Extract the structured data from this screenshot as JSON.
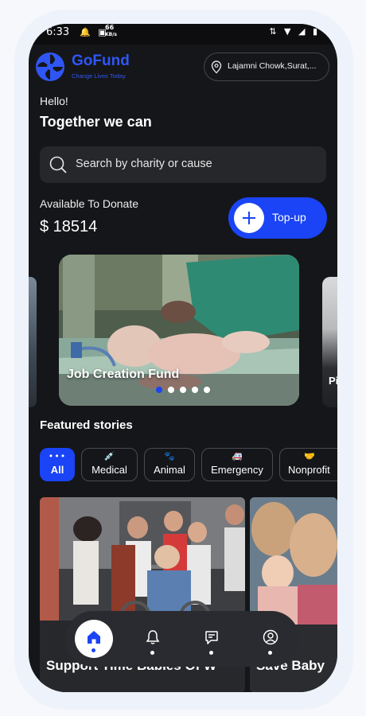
{
  "status_bar": {
    "time": "6:33",
    "net_speed_value": "66",
    "net_speed_unit": "KB/s"
  },
  "brand": {
    "name": "GoFund",
    "tagline": "Change Lives Today",
    "color": "#2f56f5"
  },
  "location": {
    "text": "Lajamni Chowk,Surat,..."
  },
  "greeting": {
    "hello": "Hello!",
    "headline": "Together we can"
  },
  "search": {
    "placeholder": "Search by charity or cause"
  },
  "wallet": {
    "label": "Available To Donate",
    "amount": "$ 18514",
    "topup_label": "Top-up"
  },
  "carousel": {
    "current_title": "Job Creation Fund",
    "next_title_partial": "Pi",
    "slide_count": 5,
    "active_index": 0
  },
  "featured": {
    "heading": "Featured stories"
  },
  "categories": [
    {
      "label": "All",
      "icon": "dots-icon",
      "active": true
    },
    {
      "label": "Medical",
      "icon": "syringe-icon",
      "active": false
    },
    {
      "label": "Animal",
      "icon": "paw-icon",
      "active": false
    },
    {
      "label": "Emergency",
      "icon": "ambulance-icon",
      "active": false
    },
    {
      "label": "Nonprofit",
      "icon": "handshake-icon",
      "active": false
    }
  ],
  "stories": [
    {
      "title": "Support Time Babies Of W"
    },
    {
      "title": "Save Baby"
    }
  ],
  "nav": [
    {
      "name": "home",
      "icon": "home-icon",
      "active": true
    },
    {
      "name": "notifications",
      "icon": "bell-icon",
      "active": false
    },
    {
      "name": "messages",
      "icon": "chat-icon",
      "active": false
    },
    {
      "name": "profile",
      "icon": "user-icon",
      "active": false
    }
  ],
  "colors": {
    "accent": "#1a44f5",
    "background": "#151619",
    "surface": "#26272b"
  }
}
